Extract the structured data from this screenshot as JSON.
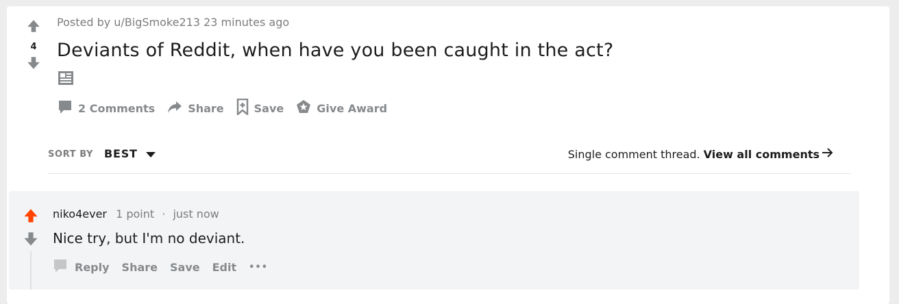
{
  "post": {
    "score": "4",
    "posted_by_prefix": "Posted by",
    "author": "u/BigSmoke213",
    "time": "23 minutes ago",
    "title": "Deviants of Reddit, when have you been caught in the act?",
    "post_type_icon": "text-post-icon"
  },
  "actions": {
    "comments": "2 Comments",
    "share": "Share",
    "save": "Save",
    "award": "Give Award"
  },
  "sort": {
    "label": "SORT BY",
    "value": "BEST"
  },
  "thread": {
    "note": "Single comment thread.",
    "view_all": "View all comments"
  },
  "comment": {
    "author": "niko4ever",
    "points": "1 point",
    "separator": "·",
    "time": "just now",
    "body": "Nice try, but I'm no deviant.",
    "actions": {
      "reply": "Reply",
      "share": "Share",
      "save": "Save",
      "edit": "Edit",
      "more": "•••"
    },
    "upvoted": true
  },
  "colors": {
    "upvote_active": "#ff4500",
    "vote_inactive": "#878a8c",
    "action_text": "#878a8c",
    "meta_text": "#7c7c7c",
    "comment_bg": "#f3f4f6"
  }
}
